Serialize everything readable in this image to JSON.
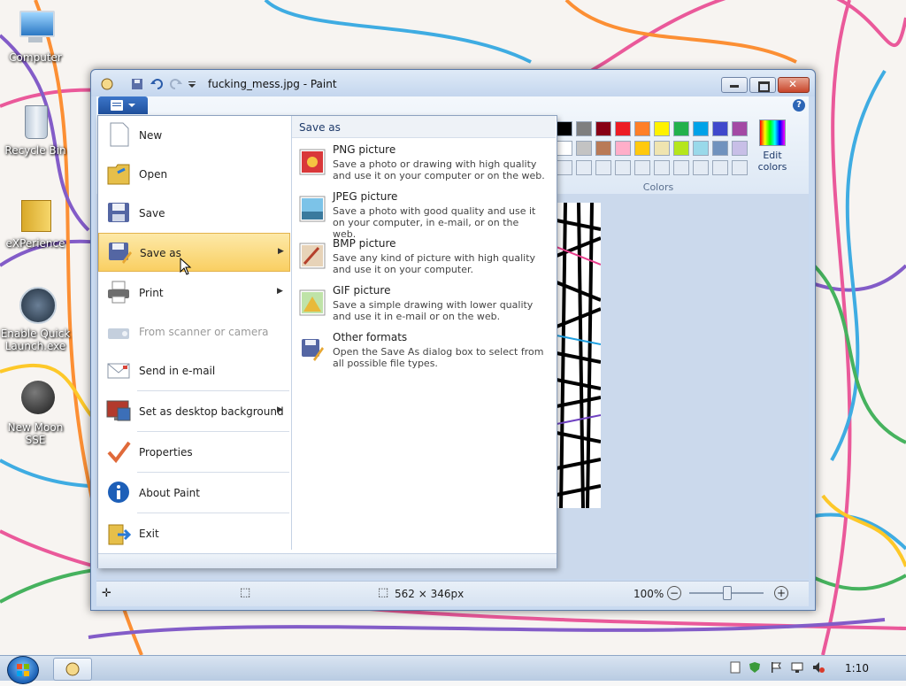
{
  "desktop": {
    "icons": [
      {
        "label": "Computer",
        "icon": "computer-icon"
      },
      {
        "label": "Recycle Bin",
        "icon": "recycle-bin-icon"
      },
      {
        "label": "eXPerience",
        "icon": "folder-icon"
      },
      {
        "label": "Enable Quick Launch.exe",
        "icon": "quick-launch-icon"
      },
      {
        "label": "New Moon SSE",
        "icon": "moon-icon"
      }
    ]
  },
  "window": {
    "title": "fucking_mess.jpg - Paint",
    "colors_label": "Colors",
    "edit_colors_label": "Edit colors",
    "help_glyph": "?",
    "palette_row1": [
      "#000000",
      "#7f7f7f",
      "#880015",
      "#ed1c24",
      "#ff7f27",
      "#fff200",
      "#22b14c",
      "#00a2e8",
      "#3f48cc",
      "#a349a4"
    ],
    "palette_row2": [
      "#ffffff",
      "#c3c3c3",
      "#b97a57",
      "#ffaec9",
      "#ffc90e",
      "#efe4b0",
      "#b5e61d",
      "#99d9ea",
      "#7092be",
      "#c8bfe7"
    ]
  },
  "file_menu": {
    "items": [
      {
        "label": "New",
        "icon": "new-document-icon"
      },
      {
        "label": "Open",
        "icon": "open-folder-icon"
      },
      {
        "label": "Save",
        "icon": "save-disk-icon"
      },
      {
        "label": "Save as",
        "icon": "save-as-icon",
        "selected": true,
        "submenu": true
      },
      {
        "label": "Print",
        "icon": "printer-icon",
        "submenu": true
      },
      {
        "label": "From scanner or camera",
        "icon": "scanner-icon",
        "disabled": true
      },
      {
        "label": "Send in e-mail",
        "icon": "email-icon"
      },
      {
        "label": "Set as desktop background",
        "icon": "desktop-background-icon",
        "submenu": true
      },
      {
        "label": "Properties",
        "icon": "checkmark-icon"
      },
      {
        "label": "About Paint",
        "icon": "info-icon"
      },
      {
        "label": "Exit",
        "icon": "exit-icon"
      }
    ],
    "save_as": {
      "header": "Save as",
      "options": [
        {
          "title": "PNG picture",
          "description": "Save a photo or drawing with high quality and use it on your computer or on the web.",
          "icon": "png-picture-icon"
        },
        {
          "title": "JPEG picture",
          "description": "Save a photo with good quality and use it on your computer, in e-mail, or on the web.",
          "icon": "jpeg-picture-icon"
        },
        {
          "title": "BMP picture",
          "description": "Save any kind of picture with high quality and use it on your computer.",
          "icon": "bmp-picture-icon"
        },
        {
          "title": "GIF picture",
          "description": "Save a simple drawing with lower quality and use it in e-mail or on the web.",
          "icon": "gif-picture-icon"
        },
        {
          "title": "Other formats",
          "description": "Open the Save As dialog box to select from all possible file types.",
          "icon": "other-formats-icon"
        }
      ]
    }
  },
  "status": {
    "image_size": "562 × 346px",
    "zoom": "100%",
    "zoom_out": "−",
    "zoom_in": "+"
  },
  "taskbar": {
    "clock": "1:10"
  }
}
